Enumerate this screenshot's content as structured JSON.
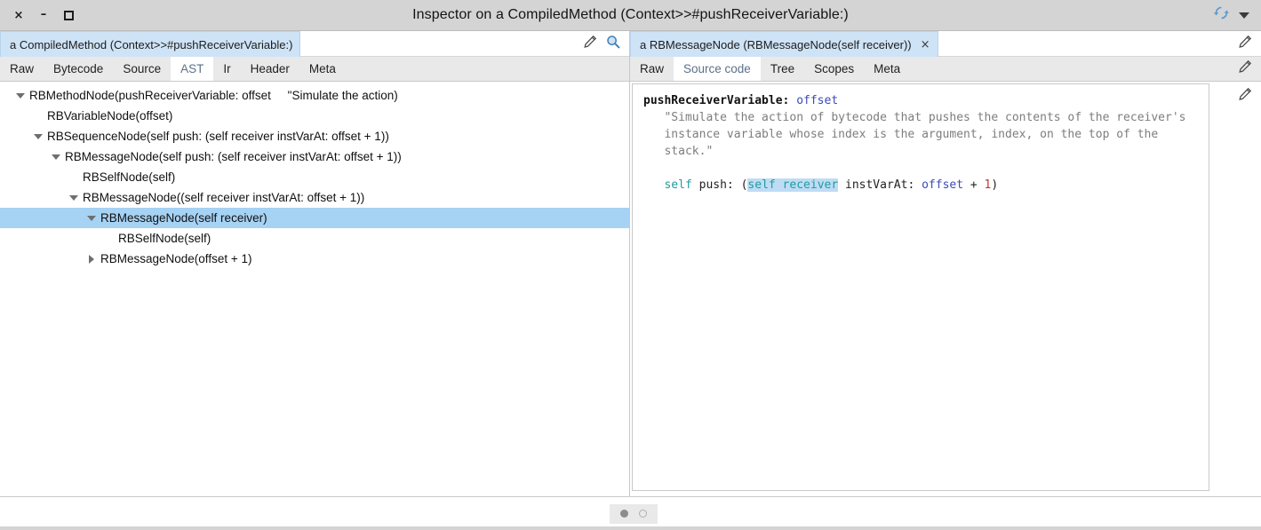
{
  "window": {
    "title": "Inspector on a CompiledMethod (Context>>#pushReceiverVariable:)",
    "controls": {
      "close": "×",
      "minimize": "–",
      "maximize": "maximize-icon"
    },
    "sync_icon": "sync-icon",
    "menu_icon": "chevron-down-icon",
    "chrome_color": "#d4d4d4"
  },
  "left_pane": {
    "breadcrumb": {
      "label": "a CompiledMethod (Context>>#pushReceiverVariable:)",
      "active_bg": "#cfe3f6"
    },
    "header_icons": {
      "pencil": "pencil-icon",
      "search": "magnifier-icon"
    },
    "tabs": [
      {
        "label": "Raw",
        "active": false
      },
      {
        "label": "Bytecode",
        "active": false
      },
      {
        "label": "Source",
        "active": false
      },
      {
        "label": "AST",
        "active": true
      },
      {
        "label": "Ir",
        "active": false
      },
      {
        "label": "Header",
        "active": false
      },
      {
        "label": "Meta",
        "active": false
      }
    ],
    "tree": [
      {
        "depth": 0,
        "twisty": "down",
        "label": "RBMethodNode(pushReceiverVariable: offset     \"Simulate the action)",
        "selected": false
      },
      {
        "depth": 1,
        "twisty": "none",
        "label": "RBVariableNode(offset)",
        "selected": false
      },
      {
        "depth": 1,
        "twisty": "down",
        "label": "RBSequenceNode(self push: (self receiver instVarAt: offset + 1))",
        "selected": false
      },
      {
        "depth": 2,
        "twisty": "down",
        "label": "RBMessageNode(self push: (self receiver instVarAt: offset + 1))",
        "selected": false
      },
      {
        "depth": 3,
        "twisty": "none",
        "label": "RBSelfNode(self)",
        "selected": false
      },
      {
        "depth": 3,
        "twisty": "down",
        "label": "RBMessageNode((self receiver instVarAt: offset + 1))",
        "selected": false
      },
      {
        "depth": 4,
        "twisty": "down",
        "label": "RBMessageNode(self receiver)",
        "selected": true
      },
      {
        "depth": 5,
        "twisty": "none",
        "label": "RBSelfNode(self)",
        "selected": false
      },
      {
        "depth": 4,
        "twisty": "right",
        "label": "RBMessageNode(offset + 1)",
        "selected": false
      }
    ]
  },
  "right_pane": {
    "breadcrumb": {
      "label": "a RBMessageNode (RBMessageNode(self receiver))",
      "close": "×",
      "active_bg": "#cfe3f6"
    },
    "header_icon": "pencil-icon",
    "tabs": [
      {
        "label": "Raw",
        "active": false
      },
      {
        "label": "Source code",
        "active": true
      },
      {
        "label": "Tree",
        "active": false
      },
      {
        "label": "Scopes",
        "active": false
      },
      {
        "label": "Meta",
        "active": false
      }
    ],
    "tab_icon": "pencil-icon",
    "source": {
      "selector": "pushReceiverVariable:",
      "argument": "offset",
      "comment_lines": [
        "\"Simulate the action of bytecode that pushes the contents of the receiver's",
        "instance variable whose index is the argument, index, on the top of the",
        "stack.\""
      ],
      "code_line": {
        "self1": "self",
        "msg": " push: (",
        "highlight": "self receiver",
        "mid": " instVarAt: ",
        "var": "offset",
        "op": " + ",
        "num": "1",
        "close": ")"
      },
      "highlight_color": "#bfdcf5"
    }
  },
  "bottom": {
    "pager": [
      {
        "state": "filled"
      },
      {
        "state": "hollow"
      }
    ]
  },
  "selection_color": "#a6d2f4"
}
